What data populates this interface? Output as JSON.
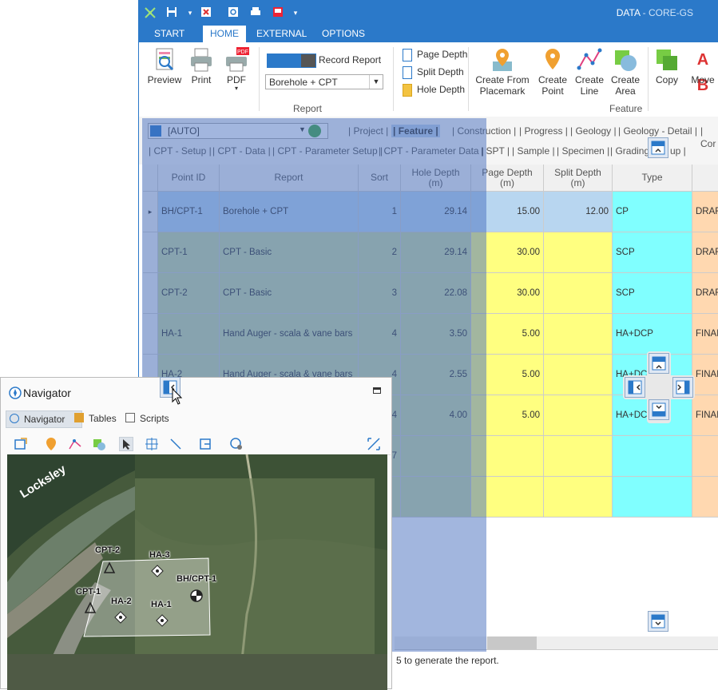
{
  "app": {
    "title": "DATA",
    "title_sep": " - ",
    "title_sub": "CORE-GS"
  },
  "ribbon_tabs": [
    "START",
    "HOME",
    "EXTERNAL",
    "OPTIONS"
  ],
  "ribbon": {
    "preview": "Preview",
    "print": "Print",
    "pdf": "PDF",
    "pdf_badge": "PDF",
    "record_report": "Record Report",
    "report_select": "Borehole + CPT",
    "group_report": "Report",
    "page_depth": "Page Depth",
    "split_depth": "Split Depth",
    "hole_depth": "Hole Depth",
    "create_from_placemark_1": "Create From",
    "create_from_placemark_2": "Placemark",
    "create_point_1": "Create",
    "create_point_2": "Point",
    "create_line_1": "Create",
    "create_line_2": "Line",
    "create_area_1": "Create",
    "create_area_2": "Area",
    "group_feature": "Feature",
    "copy": "Copy",
    "move": "Move",
    "move_letters": "A B"
  },
  "nav_strip": {
    "combo_value": "[AUTO]",
    "row1": [
      "| Project |",
      "| Feature |",
      "| Construction |",
      "| Progress |",
      "| Geology |",
      "| Geology - Detail |",
      "| Cor"
    ],
    "row2": [
      "| CPT - Setup |",
      "| CPT - Data |",
      "| CPT - Parameter Setup |",
      "| CPT - Parameter Data |",
      "| SPT |",
      "| Sample |",
      "| Specimen |",
      "| Grading",
      "up |"
    ]
  },
  "grid": {
    "columns": [
      "Point ID",
      "Report",
      "Sort",
      "Hole Depth\n(m)",
      "Page Depth\n(m)",
      "Split Depth\n(m)",
      "Type",
      ""
    ],
    "rows": [
      {
        "id": "BH/CPT-1",
        "report": "Borehole + CPT",
        "sort": "1",
        "hole": "29.14",
        "page": "15.00",
        "split": "12.00",
        "type": "CP",
        "status": "DRAFT"
      },
      {
        "id": "CPT-1",
        "report": "CPT - Basic",
        "sort": "2",
        "hole": "29.14",
        "page": "30.00",
        "split": "",
        "type": "SCP",
        "status": "DRAFT"
      },
      {
        "id": "CPT-2",
        "report": "CPT - Basic",
        "sort": "3",
        "hole": "22.08",
        "page": "30.00",
        "split": "",
        "type": "SCP",
        "status": "DRAFT"
      },
      {
        "id": "HA-1",
        "report": "Hand Auger - scala & vane bars",
        "sort": "4",
        "hole": "3.50",
        "page": "5.00",
        "split": "",
        "type": "HA+DCP",
        "status": "FINAL"
      },
      {
        "id": "HA-2",
        "report": "Hand Auger - scala & vane bars",
        "sort": "4",
        "hole": "2.55",
        "page": "5.00",
        "split": "",
        "type": "HA+DCP",
        "status": "FINAL"
      },
      {
        "id": "",
        "report": "",
        "sort": "4",
        "hole": "4.00",
        "page": "5.00",
        "split": "",
        "type": "HA+DCP",
        "status": "FINAL"
      },
      {
        "id": "",
        "report": "",
        "sort": "7",
        "hole": "",
        "page": "",
        "split": "",
        "type": "",
        "status": ""
      },
      {
        "id": "",
        "report": "",
        "sort": "",
        "hole": "",
        "page": "",
        "split": "",
        "type": "",
        "status": ""
      }
    ]
  },
  "status_text": "5 to generate the report.",
  "navigator": {
    "title": "Navigator",
    "tabs": [
      "Navigator",
      "Tables",
      "Scripts"
    ],
    "map_road_label": "Locksley",
    "points": [
      "CPT-2",
      "HA-3",
      "BH/CPT-1",
      "CPT-1",
      "HA-2",
      "HA-1"
    ]
  },
  "colors": {
    "accent": "#2b79c9",
    "yellow": "#ffff80",
    "cyan": "#80ffff",
    "peach": "#ffd8b0",
    "green": "#c8d8a0"
  }
}
